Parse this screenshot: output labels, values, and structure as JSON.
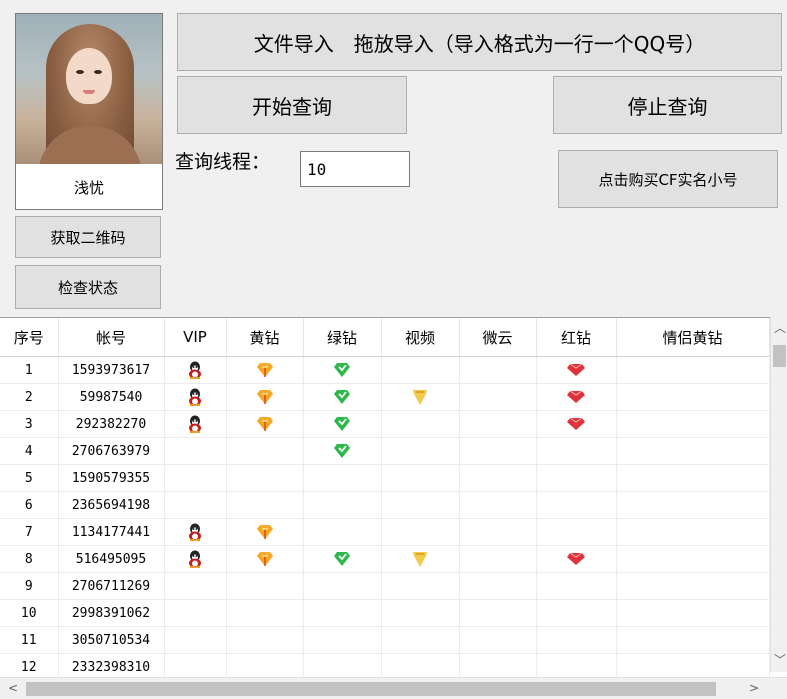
{
  "avatar": {
    "nickname": "浅忧"
  },
  "buttons": {
    "import": "文件导入　拖放导入（导入格式为一行一个QQ号）",
    "start": "开始查询",
    "stop": "停止查询",
    "buy": "点击购买CF实名小号",
    "qrcode": "获取二维码",
    "check": "检查状态"
  },
  "threads": {
    "label": "查询线程：",
    "value": "10"
  },
  "table": {
    "columns": [
      "序号",
      "帐号",
      "VIP",
      "黄钻",
      "绿钻",
      "视频",
      "微云",
      "红钻",
      "情侣黄钻"
    ],
    "rows": [
      {
        "no": "1",
        "account": "1593973617",
        "vip": true,
        "yellow": true,
        "green": true,
        "video": false,
        "weiyun": false,
        "red": true,
        "couple": false
      },
      {
        "no": "2",
        "account": "59987540",
        "vip": true,
        "yellow": true,
        "green": true,
        "video": true,
        "weiyun": false,
        "red": true,
        "couple": false
      },
      {
        "no": "3",
        "account": "292382270",
        "vip": true,
        "yellow": true,
        "green": true,
        "video": false,
        "weiyun": false,
        "red": true,
        "couple": false
      },
      {
        "no": "4",
        "account": "2706763979",
        "vip": false,
        "yellow": false,
        "green": true,
        "video": false,
        "weiyun": false,
        "red": false,
        "couple": false
      },
      {
        "no": "5",
        "account": "1590579355",
        "vip": false,
        "yellow": false,
        "green": false,
        "video": false,
        "weiyun": false,
        "red": false,
        "couple": false
      },
      {
        "no": "6",
        "account": "2365694198",
        "vip": false,
        "yellow": false,
        "green": false,
        "video": false,
        "weiyun": false,
        "red": false,
        "couple": false
      },
      {
        "no": "7",
        "account": "1134177441",
        "vip": true,
        "yellow": true,
        "green": false,
        "video": false,
        "weiyun": false,
        "red": false,
        "couple": false
      },
      {
        "no": "8",
        "account": "516495095",
        "vip": true,
        "yellow": true,
        "green": true,
        "video": true,
        "weiyun": false,
        "red": true,
        "couple": false
      },
      {
        "no": "9",
        "account": "2706711269",
        "vip": false,
        "yellow": false,
        "green": false,
        "video": false,
        "weiyun": false,
        "red": false,
        "couple": false
      },
      {
        "no": "10",
        "account": "2998391062",
        "vip": false,
        "yellow": false,
        "green": false,
        "video": false,
        "weiyun": false,
        "red": false,
        "couple": false
      },
      {
        "no": "11",
        "account": "3050710534",
        "vip": false,
        "yellow": false,
        "green": false,
        "video": false,
        "weiyun": false,
        "red": false,
        "couple": false
      },
      {
        "no": "12",
        "account": "2332398310",
        "vip": false,
        "yellow": false,
        "green": false,
        "video": false,
        "weiyun": false,
        "red": false,
        "couple": false
      }
    ]
  },
  "icons": {
    "vip": "qq-penguin-icon",
    "yellow": "yellow-diamond-icon",
    "green": "green-diamond-icon",
    "video": "video-vip-icon",
    "red": "red-diamond-icon"
  },
  "colors": {
    "yellow_diamond": "#f5a623",
    "green_diamond": "#2eb84b",
    "video_icon": "#f2c94c",
    "red_diamond": "#e0323a",
    "penguin": "#c81e1e"
  }
}
